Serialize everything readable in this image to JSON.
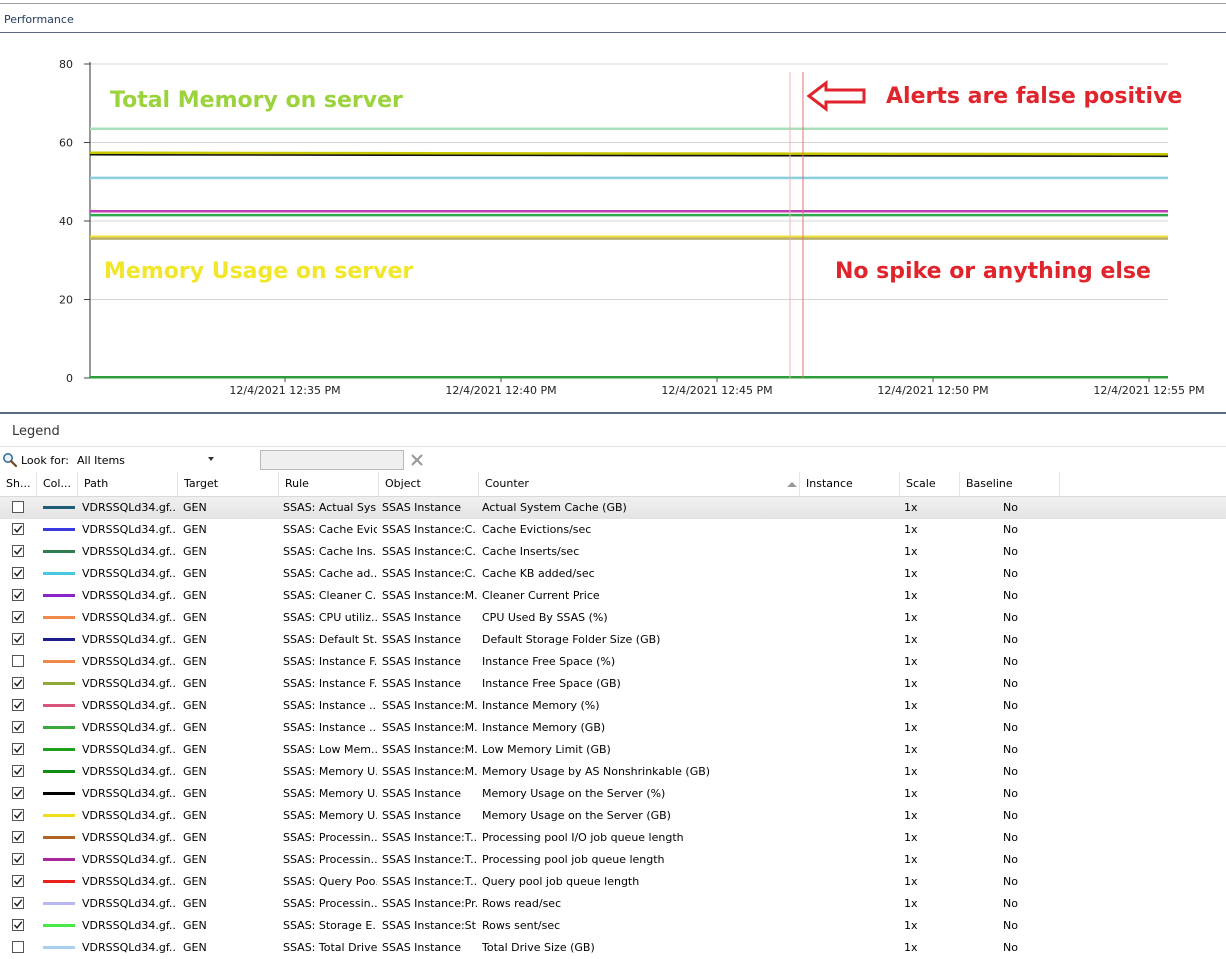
{
  "header": {
    "title": "Performance"
  },
  "chart_data": {
    "type": "line",
    "y_ticks": [
      "0",
      "20",
      "40",
      "60",
      "80"
    ],
    "ylim": [
      0,
      80
    ],
    "x_ticks": [
      "12/4/2021 12:35 PM",
      "12/4/2021 12:40 PM",
      "12/4/2021 12:45 PM",
      "12/4/2021 12:50 PM",
      "12/4/2021 12:55 PM"
    ],
    "grid": true,
    "series": [
      {
        "color": "#a8dfb8",
        "values": [
          63.5,
          63.5
        ]
      },
      {
        "color": "#111111",
        "values": [
          57,
          56.6
        ]
      },
      {
        "color": "#c7c700",
        "values": [
          57.4,
          57
        ]
      },
      {
        "color": "#8cd0df",
        "values": [
          51,
          51
        ]
      },
      {
        "color": "#c03fb4",
        "values": [
          42.5,
          42.5
        ]
      },
      {
        "color": "#2fa84f",
        "values": [
          41.5,
          41.5
        ]
      },
      {
        "color": "#f2e23a",
        "values": [
          36,
          36
        ]
      },
      {
        "color": "#b9b070",
        "values": [
          35.5,
          35.5
        ]
      },
      {
        "color": "#2e9e3a",
        "values": [
          0.2,
          0.2
        ]
      }
    ],
    "annotations": [
      {
        "text": "Total Memory on server",
        "color": "#9bd33c"
      },
      {
        "text": "Alerts are false positive",
        "color": "#e0242b"
      },
      {
        "text": "Memory Usage on server",
        "color": "#f2e62a"
      },
      {
        "text": "No spike or anything else",
        "color": "#e0242b"
      }
    ]
  },
  "legend": {
    "title": "Legend",
    "look_for_label": "Look for:",
    "scope_value": "All Items",
    "search_value": "",
    "columns": [
      "Sh...",
      "Col...",
      "Path",
      "Target",
      "Rule",
      "Object",
      "Counter",
      "Instance",
      "Scale",
      "Baseline"
    ],
    "rows": [
      {
        "shown": false,
        "color": "#1f5c78",
        "path": "VDRSSQLd34.gf...",
        "target": "GEN",
        "rule": "SSAS: Actual Sys...",
        "object": "SSAS Instance",
        "counter": "Actual System Cache (GB)",
        "instance": "",
        "scale": "1x",
        "baseline": "No"
      },
      {
        "shown": true,
        "color": "#3a3adf",
        "path": "VDRSSQLd34.gf...",
        "target": "GEN",
        "rule": "SSAS: Cache Evic...",
        "object": "SSAS Instance:C...",
        "counter": "Cache Evictions/sec",
        "instance": "",
        "scale": "1x",
        "baseline": "No"
      },
      {
        "shown": true,
        "color": "#2e7d4f",
        "path": "VDRSSQLd34.gf...",
        "target": "GEN",
        "rule": "SSAS: Cache Ins...",
        "object": "SSAS Instance:C...",
        "counter": "Cache Inserts/sec",
        "instance": "",
        "scale": "1x",
        "baseline": "No"
      },
      {
        "shown": true,
        "color": "#48c8e0",
        "path": "VDRSSQLd34.gf...",
        "target": "GEN",
        "rule": "SSAS: Cache ad...",
        "object": "SSAS Instance:C...",
        "counter": "Cache KB added/sec",
        "instance": "",
        "scale": "1x",
        "baseline": "No"
      },
      {
        "shown": true,
        "color": "#8a24c8",
        "path": "VDRSSQLd34.gf...",
        "target": "GEN",
        "rule": "SSAS: Cleaner C...",
        "object": "SSAS Instance:M...",
        "counter": "Cleaner Current Price",
        "instance": "",
        "scale": "1x",
        "baseline": "No"
      },
      {
        "shown": true,
        "color": "#f08a48",
        "path": "VDRSSQLd34.gf...",
        "target": "GEN",
        "rule": "SSAS: CPU utiliz...",
        "object": "SSAS Instance",
        "counter": "CPU Used By SSAS (%)",
        "instance": "",
        "scale": "1x",
        "baseline": "No"
      },
      {
        "shown": true,
        "color": "#1e1e8c",
        "path": "VDRSSQLd34.gf...",
        "target": "GEN",
        "rule": "SSAS: Default St...",
        "object": "SSAS Instance",
        "counter": "Default Storage Folder Size (GB)",
        "instance": "",
        "scale": "1x",
        "baseline": "No"
      },
      {
        "shown": false,
        "color": "#f08a48",
        "path": "VDRSSQLd34.gf...",
        "target": "GEN",
        "rule": "SSAS: Instance F...",
        "object": "SSAS Instance",
        "counter": "Instance Free Space (%)",
        "instance": "",
        "scale": "1x",
        "baseline": "No"
      },
      {
        "shown": true,
        "color": "#8fa83a",
        "path": "VDRSSQLd34.gf...",
        "target": "GEN",
        "rule": "SSAS: Instance F...",
        "object": "SSAS Instance",
        "counter": "Instance Free Space (GB)",
        "instance": "",
        "scale": "1x",
        "baseline": "No"
      },
      {
        "shown": true,
        "color": "#d8557a",
        "path": "VDRSSQLd34.gf...",
        "target": "GEN",
        "rule": "SSAS: Instance ...",
        "object": "SSAS Instance:M...",
        "counter": "Instance Memory (%)",
        "instance": "",
        "scale": "1x",
        "baseline": "No"
      },
      {
        "shown": true,
        "color": "#3aa83a",
        "path": "VDRSSQLd34.gf...",
        "target": "GEN",
        "rule": "SSAS: Instance ...",
        "object": "SSAS Instance:M...",
        "counter": "Instance Memory (GB)",
        "instance": "",
        "scale": "1x",
        "baseline": "No"
      },
      {
        "shown": true,
        "color": "#1ea01e",
        "path": "VDRSSQLd34.gf...",
        "target": "GEN",
        "rule": "SSAS: Low Mem...",
        "object": "SSAS Instance:M...",
        "counter": "Low Memory Limit (GB)",
        "instance": "",
        "scale": "1x",
        "baseline": "No"
      },
      {
        "shown": true,
        "color": "#138c13",
        "path": "VDRSSQLd34.gf...",
        "target": "GEN",
        "rule": "SSAS: Memory U...",
        "object": "SSAS Instance:M...",
        "counter": "Memory Usage by AS Nonshrinkable (GB)",
        "instance": "",
        "scale": "1x",
        "baseline": "No"
      },
      {
        "shown": true,
        "color": "#000000",
        "path": "VDRSSQLd34.gf...",
        "target": "GEN",
        "rule": "SSAS: Memory U...",
        "object": "SSAS Instance",
        "counter": "Memory Usage on the Server (%)",
        "instance": "",
        "scale": "1x",
        "baseline": "No"
      },
      {
        "shown": true,
        "color": "#f0de1a",
        "path": "VDRSSQLd34.gf...",
        "target": "GEN",
        "rule": "SSAS: Memory U...",
        "object": "SSAS Instance",
        "counter": "Memory Usage on the Server (GB)",
        "instance": "",
        "scale": "1x",
        "baseline": "No"
      },
      {
        "shown": true,
        "color": "#b06428",
        "path": "VDRSSQLd34.gf...",
        "target": "GEN",
        "rule": "SSAS: Processin...",
        "object": "SSAS Instance:T...",
        "counter": "Processing pool I/O job queue length",
        "instance": "",
        "scale": "1x",
        "baseline": "No"
      },
      {
        "shown": true,
        "color": "#a8289a",
        "path": "VDRSSQLd34.gf...",
        "target": "GEN",
        "rule": "SSAS: Processin...",
        "object": "SSAS Instance:T...",
        "counter": "Processing pool job queue length",
        "instance": "",
        "scale": "1x",
        "baseline": "No"
      },
      {
        "shown": true,
        "color": "#e8201e",
        "path": "VDRSSQLd34.gf...",
        "target": "GEN",
        "rule": "SSAS: Query Poo...",
        "object": "SSAS Instance:T...",
        "counter": "Query pool job queue length",
        "instance": "",
        "scale": "1x",
        "baseline": "No"
      },
      {
        "shown": true,
        "color": "#b8b8f0",
        "path": "VDRSSQLd34.gf...",
        "target": "GEN",
        "rule": "SSAS: Processin...",
        "object": "SSAS Instance:Pr...",
        "counter": "Rows read/sec",
        "instance": "",
        "scale": "1x",
        "baseline": "No"
      },
      {
        "shown": true,
        "color": "#48e848",
        "path": "VDRSSQLd34.gf...",
        "target": "GEN",
        "rule": "SSAS: Storage E...",
        "object": "SSAS Instance:St...",
        "counter": "Rows sent/sec",
        "instance": "",
        "scale": "1x",
        "baseline": "No"
      },
      {
        "shown": false,
        "color": "#a8d0f0",
        "path": "VDRSSQLd34.gf...",
        "target": "GEN",
        "rule": "SSAS: Total Drive...",
        "object": "SSAS Instance",
        "counter": "Total Drive Size (GB)",
        "instance": "",
        "scale": "1x",
        "baseline": "No"
      }
    ]
  }
}
